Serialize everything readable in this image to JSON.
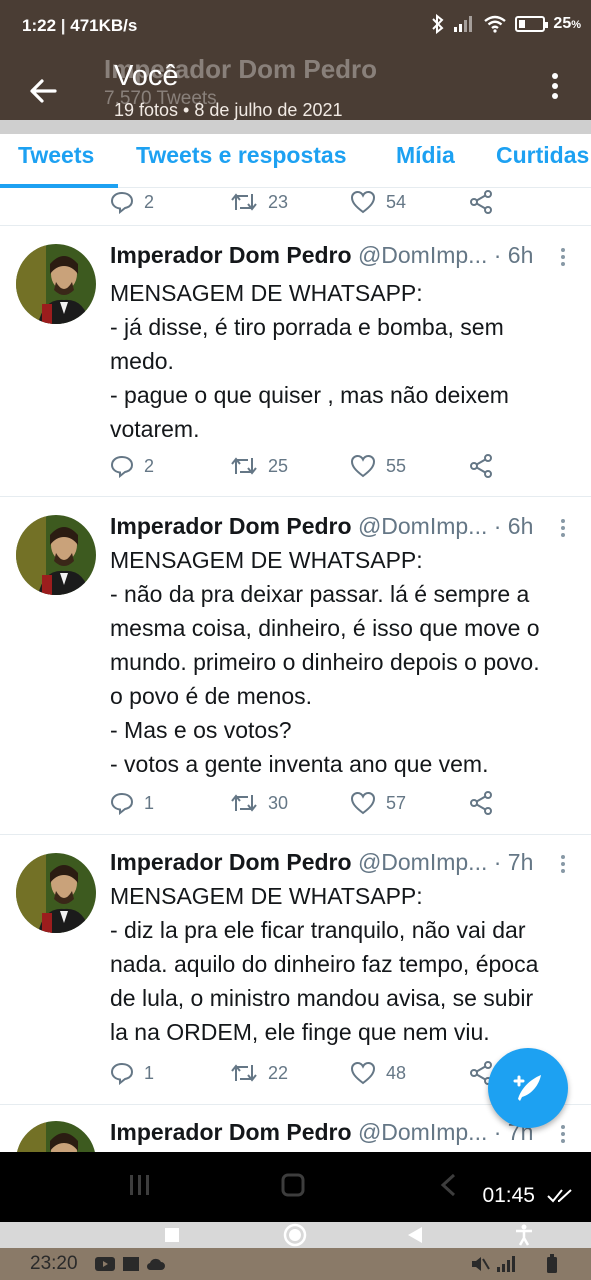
{
  "status_bar": {
    "time": "1:22",
    "speed": "471KB/s",
    "battery": "25",
    "battery_unit": "%"
  },
  "header": {
    "ghost_title": "Imperador Dom Pedro",
    "ghost_subtitle": "7.570 Tweets",
    "title": "Você",
    "subtitle": "19 fotos  •  8 de julho de 2021"
  },
  "tabs": [
    {
      "label": "Tweets",
      "active": true
    },
    {
      "label": "Tweets e respostas",
      "active": false
    },
    {
      "label": "Mídia",
      "active": false
    },
    {
      "label": "Curtidas",
      "active": false
    }
  ],
  "partial_tweet": {
    "replies": "2",
    "retweets": "23",
    "likes": "54"
  },
  "tweets": [
    {
      "name": "Imperador Dom Pedro",
      "handle": "@DomImp...",
      "time": "· 6h",
      "lines": [
        "MENSAGEM DE WHATSAPP:",
        "- já disse, é tiro porrada e bomba, sem",
        "medo.",
        "- pague o que quiser , mas não deixem",
        "votarem."
      ],
      "replies": "2",
      "retweets": "25",
      "likes": "55"
    },
    {
      "name": "Imperador Dom Pedro",
      "handle": "@DomImp...",
      "time": "· 6h",
      "lines": [
        "MENSAGEM DE WHATSAPP:",
        "- não da pra deixar passar. lá é sempre a",
        "mesma coisa, dinheiro, é isso que move o",
        "mundo. primeiro o dinheiro depois o povo.",
        "o povo é de menos.",
        "- Mas e os votos?",
        "- votos a gente inventa ano que vem."
      ],
      "replies": "1",
      "retweets": "30",
      "likes": "57"
    },
    {
      "name": "Imperador Dom Pedro",
      "handle": "@DomImp...",
      "time": "· 7h",
      "lines": [
        "MENSAGEM DE WHATSAPP:",
        "- diz la pra ele ficar tranquilo, não vai dar",
        "nada. aquilo do dinheiro faz tempo, época",
        "de lula,  o ministro mandou avisa, se subir",
        "la na ORDEM,  ele finge que nem viu."
      ],
      "replies": "1",
      "retweets": "22",
      "likes": "48"
    },
    {
      "name": "Imperador Dom Pedro",
      "handle": "@DomImp...",
      "time": "· 7h",
      "lines": [],
      "replies": "",
      "retweets": "",
      "likes": ""
    }
  ],
  "media_viewer": {
    "time": "01:45"
  },
  "bottom_status": {
    "time": "23:20"
  },
  "colors": {
    "accent": "#1da1f2",
    "header_bg": "#4a3d34",
    "muted_text": "#657786"
  },
  "icons": [
    "back-arrow-icon",
    "more-vertical-icon",
    "reply-icon",
    "retweet-icon",
    "like-icon",
    "share-icon",
    "compose-tweet-icon"
  ]
}
